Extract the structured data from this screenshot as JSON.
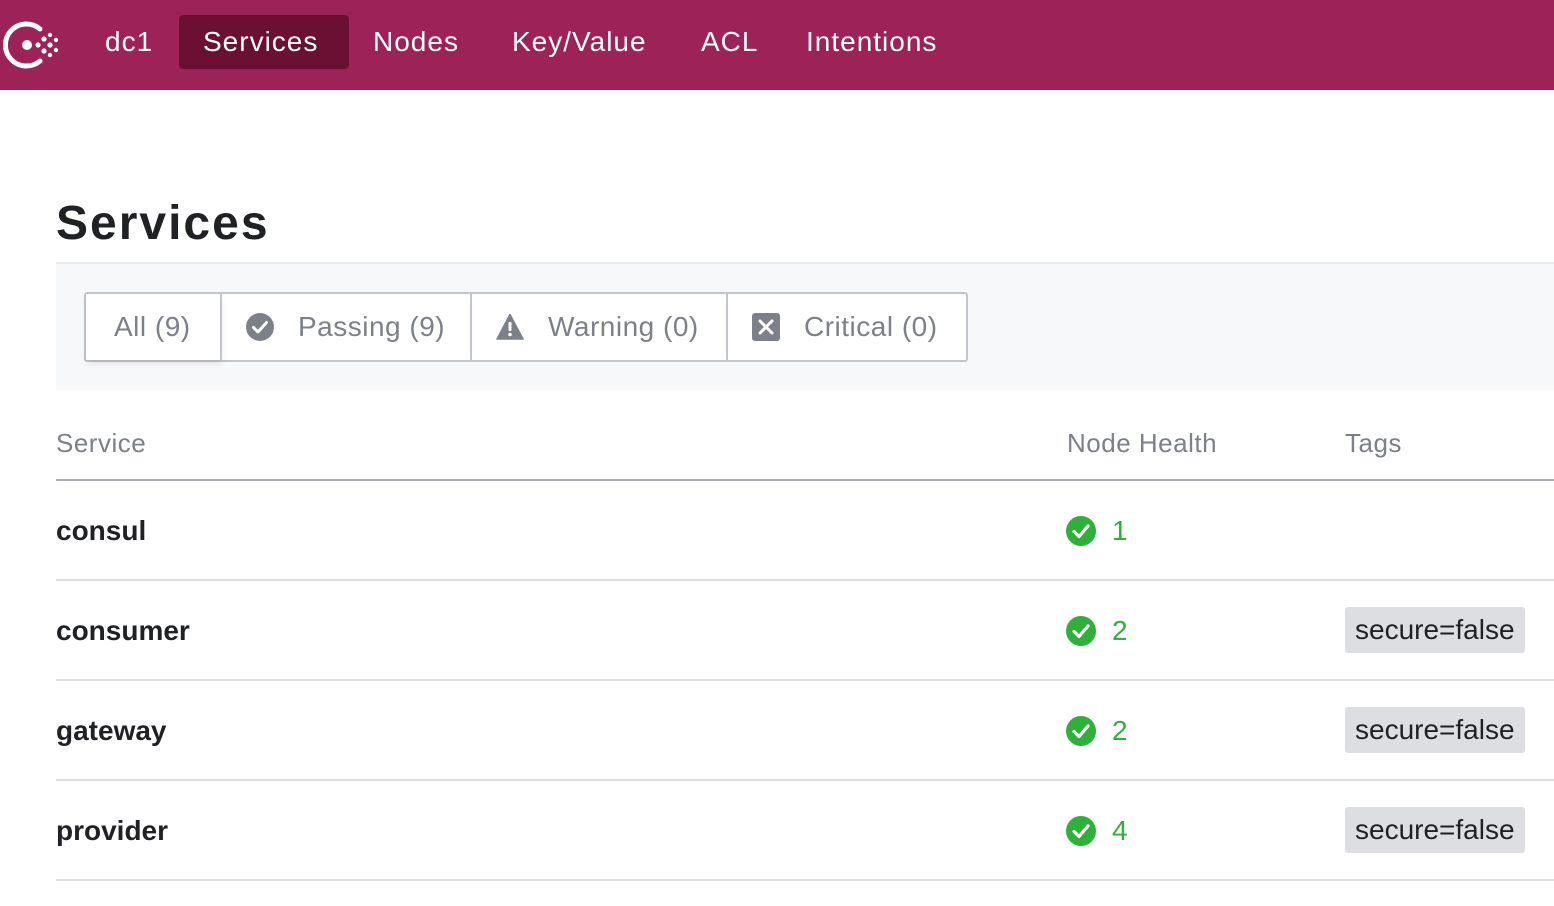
{
  "nav": {
    "datacenter": "dc1",
    "items": [
      {
        "label": "Services",
        "active": true
      },
      {
        "label": "Nodes",
        "active": false
      },
      {
        "label": "Key/Value",
        "active": false
      },
      {
        "label": "ACL",
        "active": false
      },
      {
        "label": "Intentions",
        "active": false
      }
    ],
    "logo_icon": "consul-logo-icon"
  },
  "page": {
    "title": "Services"
  },
  "filters": [
    {
      "label": "All (9)",
      "icon": null,
      "selected": true
    },
    {
      "label": "Passing (9)",
      "icon": "check-circle-icon",
      "selected": false
    },
    {
      "label": "Warning (0)",
      "icon": "warning-triangle-icon",
      "selected": false
    },
    {
      "label": "Critical (0)",
      "icon": "x-square-icon",
      "selected": false
    }
  ],
  "table": {
    "headers": {
      "service": "Service",
      "health": "Node Health",
      "tags": "Tags"
    },
    "rows": [
      {
        "name": "consul",
        "health_count": "1",
        "tag": ""
      },
      {
        "name": "consumer",
        "health_count": "2",
        "tag": "secure=false"
      },
      {
        "name": "gateway",
        "health_count": "2",
        "tag": "secure=false"
      },
      {
        "name": "provider",
        "health_count": "4",
        "tag": "secure=false"
      }
    ]
  },
  "colors": {
    "brand": "#9c2257",
    "nav_active": "#6b0f33",
    "passing": "#2eb039",
    "muted_text": "#7c8088",
    "tag_bg": "#dcdee2"
  }
}
